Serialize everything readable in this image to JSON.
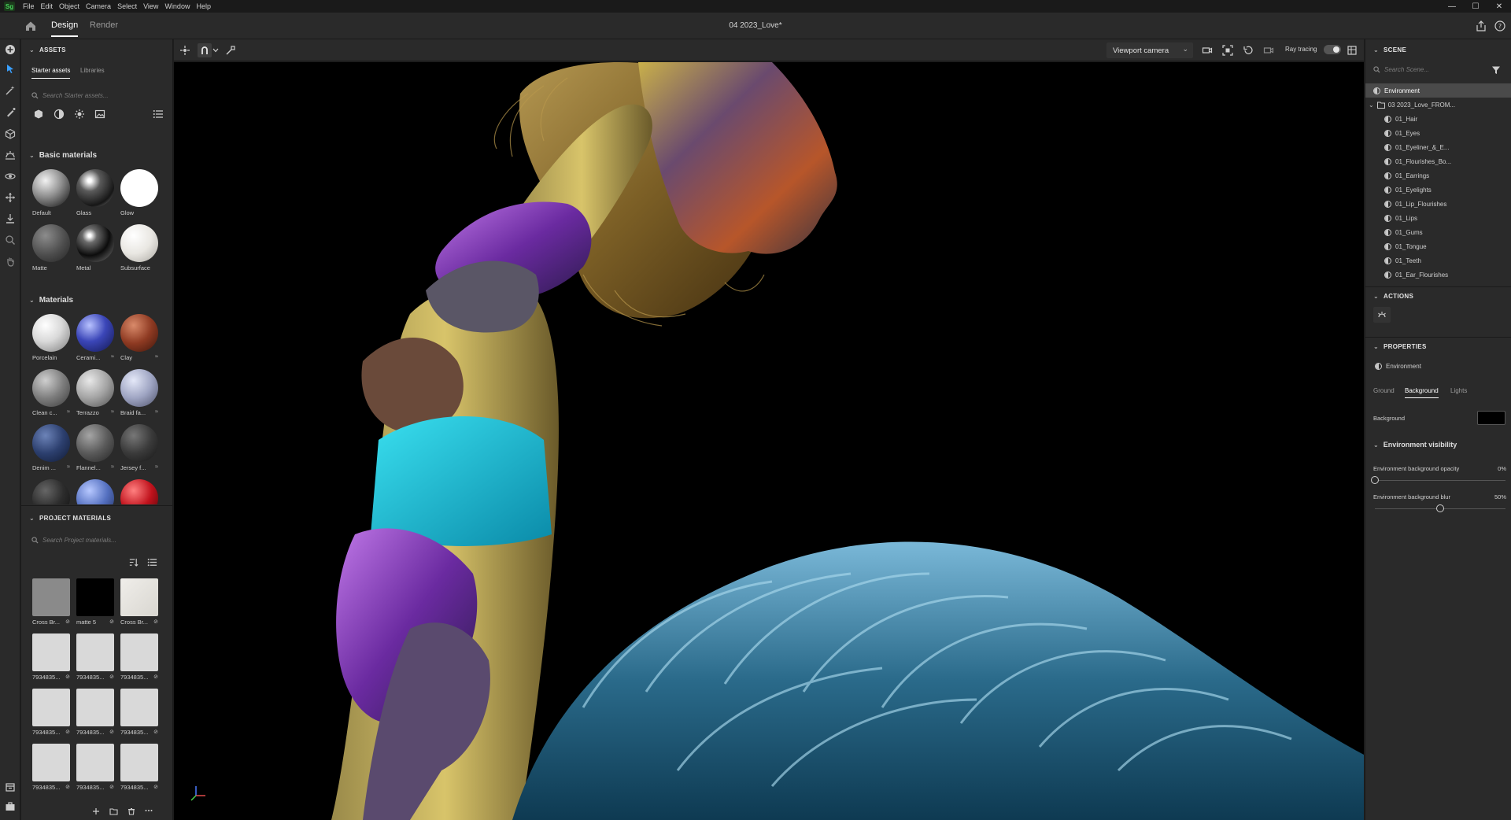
{
  "menubar": {
    "logo": "Sg",
    "items": [
      "File",
      "Edit",
      "Object",
      "Camera",
      "Select",
      "View",
      "Window",
      "Help"
    ],
    "window_controls": [
      "—",
      "☐",
      "✕"
    ]
  },
  "titlebar": {
    "tabs": [
      "Design",
      "Render"
    ],
    "active_tab": "Design",
    "document_title": "04 2023_Love*"
  },
  "assets": {
    "title": "ASSETS",
    "tabs": [
      "Starter assets",
      "Libraries"
    ],
    "search_placeholder": "Search Starter assets...",
    "basic_materials": {
      "title": "Basic materials",
      "items": [
        "Default",
        "Glass",
        "Glow",
        "Matte",
        "Metal",
        "Subsurface"
      ]
    },
    "materials": {
      "title": "Materials",
      "items": [
        "Porcelain",
        "Cerami...",
        "Clay",
        "Clean c...",
        "Terrazzo",
        "Braid fa...",
        "Denim ...",
        "Flannel...",
        "Jersey f..."
      ]
    },
    "project_materials": {
      "title": "PROJECT MATERIALS",
      "search_placeholder": "Search Project materials...",
      "items": [
        "Cross Br...",
        "matte 5",
        "Cross Br...",
        "7934835...",
        "7934835...",
        "7934835...",
        "7934835...",
        "7934835...",
        "7934835...",
        "7934835...",
        "7934835...",
        "7934835..."
      ]
    }
  },
  "viewport_toolbar": {
    "camera": "Viewport camera",
    "ray_tracing_label": "Ray tracing",
    "ray_tracing_on": true
  },
  "scene": {
    "title": "SCENE",
    "search_placeholder": "Search Scene...",
    "environment": "Environment",
    "group": "03 2023_Love_FROM...",
    "children": [
      "01_Hair",
      "01_Eyes",
      "01_Eyeliner_&_E...",
      "01_Flourishes_Bo...",
      "01_Earrings",
      "01_Eyelights",
      "01_Lip_Flourishes",
      "01_Lips",
      "01_Gums",
      "01_Tongue",
      "01_Teeth",
      "01_Ear_Flourishes"
    ]
  },
  "actions": {
    "title": "ACTIONS"
  },
  "properties": {
    "title": "PROPERTIES",
    "selected": "Environment",
    "tabs": [
      "Ground",
      "Background",
      "Lights"
    ],
    "active_tab": "Background",
    "background_label": "Background",
    "background_color": "#000000",
    "env_visibility_title": "Environment visibility",
    "opacity_label": "Environment background opacity",
    "opacity_value": "0%",
    "opacity_fraction": 0,
    "blur_label": "Environment background blur",
    "blur_value": "50%",
    "blur_fraction": 0.5
  },
  "colors": {
    "accent": "#47d05a",
    "panel": "#2a2a2a",
    "highlight": "#4a4a4a"
  }
}
